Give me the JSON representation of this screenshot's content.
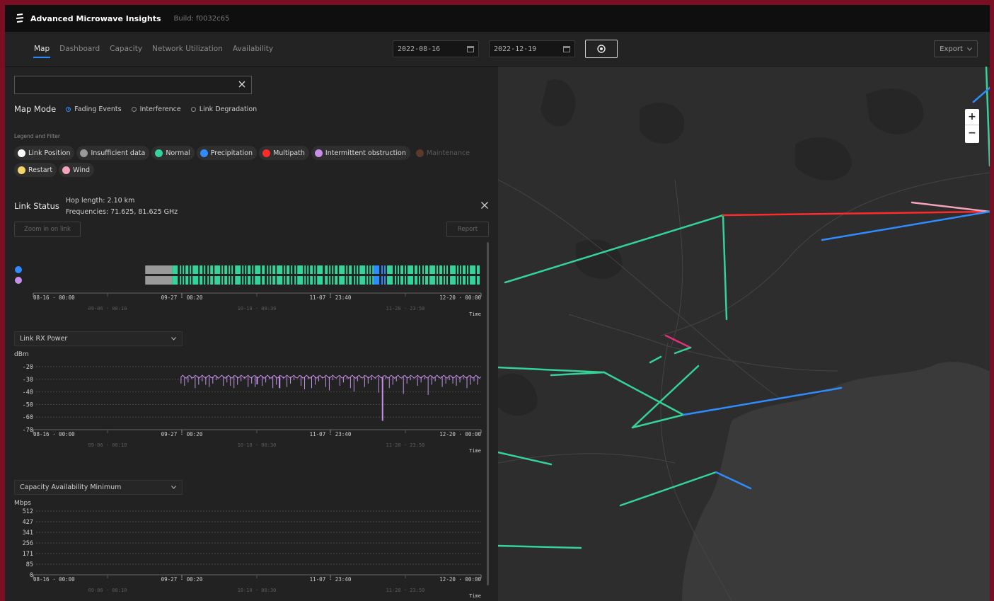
{
  "header": {
    "app_title": "Advanced Microwave Insights",
    "build": "Build: f0032c65"
  },
  "nav": {
    "tabs": [
      {
        "label": "Map",
        "active": true
      },
      {
        "label": "Dashboard"
      },
      {
        "label": "Capacity"
      },
      {
        "label": "Network Utilization"
      },
      {
        "label": "Availability"
      }
    ],
    "start_date": "2022-08-16",
    "end_date": "2022-12-19",
    "export_label": "Export"
  },
  "left": {
    "search": {
      "value": ""
    },
    "map_mode": {
      "label": "Map Mode",
      "options": [
        "Fading Events",
        "Interference",
        "Link Degradation"
      ],
      "selected": "Fading Events"
    },
    "legend_title": "Legend and Filter",
    "legend": [
      {
        "label": "Link Position",
        "color": "#ffffff"
      },
      {
        "label": "Insufficient data",
        "color": "#9a9a9a"
      },
      {
        "label": "Normal",
        "color": "#35d39a"
      },
      {
        "label": "Precipitation",
        "color": "#2f8cff"
      },
      {
        "label": "Multipath",
        "color": "#ff2b2b"
      },
      {
        "label": "Intermittent obstruction",
        "color": "#c690ea"
      },
      {
        "label": "Maintenance",
        "color": "#5a3a28",
        "disabled": true
      },
      {
        "label": "Restart",
        "color": "#f3d46a"
      },
      {
        "label": "Wind",
        "color": "#f5a3b9"
      }
    ],
    "link_status": {
      "title": "Link Status",
      "hop_length": "Hop length: 2.10 km",
      "frequencies": "Frequencies: 71.625, 81.625 GHz",
      "zoom_button": "Zoom in on link",
      "report_button": "Report"
    },
    "time_axis": {
      "major": [
        "08-16 · 00:00",
        "09-27 · 00:20",
        "11-07 · 23:40",
        "12-20 · 00:00"
      ],
      "minor": [
        "09-06 · 00:10",
        "10-18 · 00:30",
        "11-28 · 23:50"
      ],
      "label": "Time"
    },
    "rx_power": {
      "select_label": "Link RX Power",
      "unit": "dBm",
      "ticks": [
        "-20",
        "-30",
        "-40",
        "-50",
        "-60",
        "-70"
      ]
    },
    "capacity": {
      "select_label": "Capacity Availability Minimum",
      "unit": "Mbps",
      "ticks": [
        "512",
        "427",
        "341",
        "256",
        "171",
        "85",
        "0"
      ]
    }
  },
  "chart_data": [
    {
      "type": "bar",
      "title": "",
      "series": [
        {
          "color": "#2f8cff"
        },
        {
          "color": "#c690ea"
        }
      ],
      "segments": [
        {
          "from": 0.25,
          "to": 0.31,
          "status": "Insufficient data"
        },
        {
          "from": 0.31,
          "to": 0.76,
          "status": "Normal"
        },
        {
          "from": 0.76,
          "to": 0.79,
          "status": "Precipitation"
        },
        {
          "from": 0.79,
          "to": 1.0,
          "status": "Normal"
        }
      ]
    },
    {
      "type": "line",
      "ylabel": "dBm",
      "ylim": [
        -70,
        -20
      ],
      "x_range": [
        "2022-08-16",
        "2022-12-20"
      ],
      "baseline": -28,
      "dips": [
        {
          "x": 0.78,
          "y": -63
        },
        {
          "x": 0.55,
          "y": -37
        },
        {
          "x": 0.5,
          "y": -34
        }
      ]
    },
    {
      "type": "line",
      "ylabel": "Mbps",
      "ylim": [
        0,
        512
      ],
      "series": []
    }
  ],
  "map": {
    "links": [
      {
        "status": "Normal",
        "color": "#35d39a"
      },
      {
        "status": "Multipath",
        "color": "#ff2b2b"
      },
      {
        "status": "Precipitation",
        "color": "#2f8cff"
      },
      {
        "status": "Wind",
        "color": "#f5a3b9"
      },
      {
        "status": "Other",
        "color": "#e0307a"
      }
    ],
    "zoom_in": "+",
    "zoom_out": "−"
  }
}
